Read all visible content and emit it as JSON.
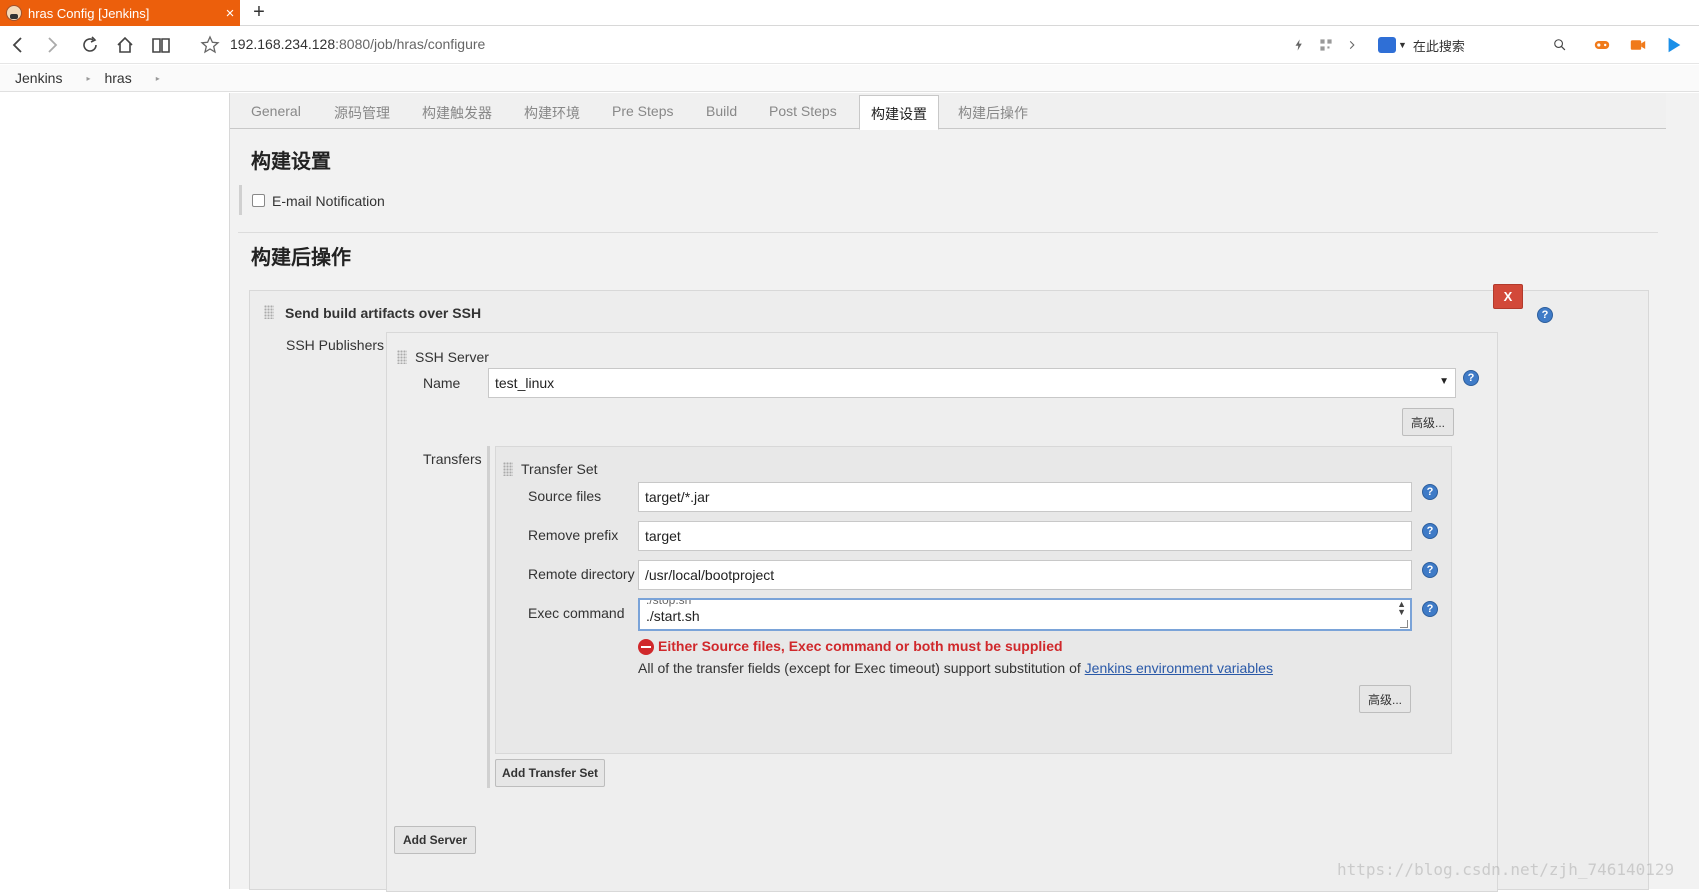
{
  "browser": {
    "tab_title": "hras Config [Jenkins]",
    "tab_close": "×",
    "new_tab": "+",
    "url_host": "192.168.234.128",
    "url_rest": ":8080/job/hras/configure",
    "search_placeholder": "在此搜索"
  },
  "breadcrumb": {
    "items": [
      "Jenkins",
      "hras"
    ],
    "separator": "▸"
  },
  "tabs": [
    "General",
    "源码管理",
    "构建触发器",
    "构建环境",
    "Pre Steps",
    "Build",
    "Post Steps",
    "构建设置",
    "构建后操作"
  ],
  "active_tab": "构建设置",
  "build_settings": {
    "title": "构建设置",
    "email_notification_label": "E-mail Notification",
    "email_notification_checked": false
  },
  "post_build": {
    "title": "构建后操作",
    "delete_label": "X",
    "publisher_title": "Send build artifacts over SSH",
    "ssh_publishers_label": "SSH Publishers",
    "ssh_server_label": "SSH Server",
    "name_label": "Name",
    "name_value": "test_linux",
    "advanced_label": "高级...",
    "transfers_label": "Transfers",
    "transfer_set_label": "Transfer Set",
    "source_files_label": "Source files",
    "source_files_value": "target/*.jar",
    "remove_prefix_label": "Remove prefix",
    "remove_prefix_value": "target",
    "remote_directory_label": "Remote directory",
    "remote_directory_value": "/usr/local/bootproject",
    "exec_command_label": "Exec command",
    "exec_command_prev_line": "./stop.sh",
    "exec_command_value": "./start.sh",
    "error_message": "Either Source files, Exec command or both must be supplied",
    "info_message": "All of the transfer fields (except for Exec timeout) support substitution of",
    "info_link": "Jenkins environment variables",
    "transfer_advanced_label": "高级...",
    "add_transfer_set_label": "Add Transfer Set",
    "add_server_label": "Add Server",
    "help_glyph": "?"
  },
  "watermark": "https://blog.csdn.net/zjh_746140129",
  "colors": {
    "tab_active": "#ec5f0c",
    "delete_button": "#d24939",
    "help_icon": "#3f7bc7",
    "error": "#d0282b",
    "link": "#2a59a8"
  }
}
